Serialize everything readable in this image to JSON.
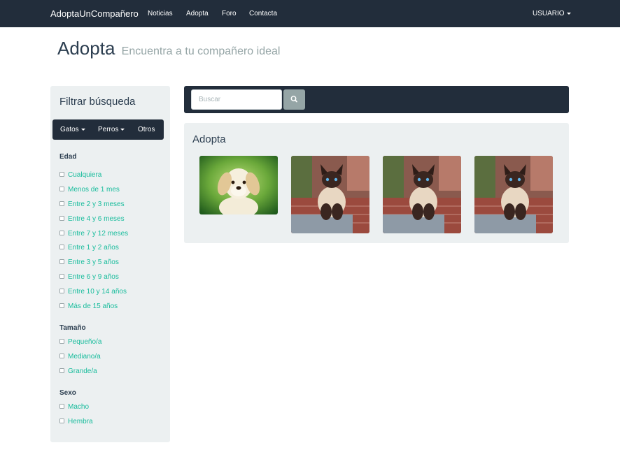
{
  "navbar": {
    "brand": "AdoptaUnCompañero",
    "links": [
      "Noticias",
      "Adopta",
      "Foro",
      "Contacta"
    ],
    "user": "USUARIO"
  },
  "header": {
    "title": "Adopta",
    "subtitle": "Encuentra a tu compañero ideal"
  },
  "sidebar": {
    "title": "Filtrar búsqueda",
    "tabs": [
      "Gatos",
      "Perros",
      "Otros"
    ],
    "edad": {
      "label": "Edad",
      "options": [
        "Cualquiera",
        "Menos de 1 mes",
        "Entre 2 y 3 meses",
        "Entre 4 y 6 meses",
        "Entre 7 y 12 meses",
        "Entre 1 y 2 años",
        "Entre 3 y 5 años",
        "Entre 6 y 9 años",
        "Entre 10 y 14 años",
        "Más de 15 años"
      ]
    },
    "tamano": {
      "label": "Tamaño",
      "options": [
        "Pequeño/a",
        "Mediano/a",
        "Grande/a"
      ]
    },
    "sexo": {
      "label": "Sexo",
      "options": [
        "Macho",
        "Hembra"
      ]
    }
  },
  "search": {
    "placeholder": "Buscar",
    "value": ""
  },
  "adopta": {
    "title": "Adopta",
    "pets": [
      {
        "image": "puppy-photo"
      },
      {
        "image": "siamese-cat-photo"
      },
      {
        "image": "siamese-cat-photo"
      },
      {
        "image": "siamese-cat-photo"
      }
    ]
  },
  "colors": {
    "navbar": "#222d3b",
    "panel": "#ecf0f1",
    "link": "#18bc9c",
    "text": "#2c3e50",
    "muted": "#95a5a6"
  },
  "icons": [
    "search-icon",
    "caret-down-icon"
  ]
}
